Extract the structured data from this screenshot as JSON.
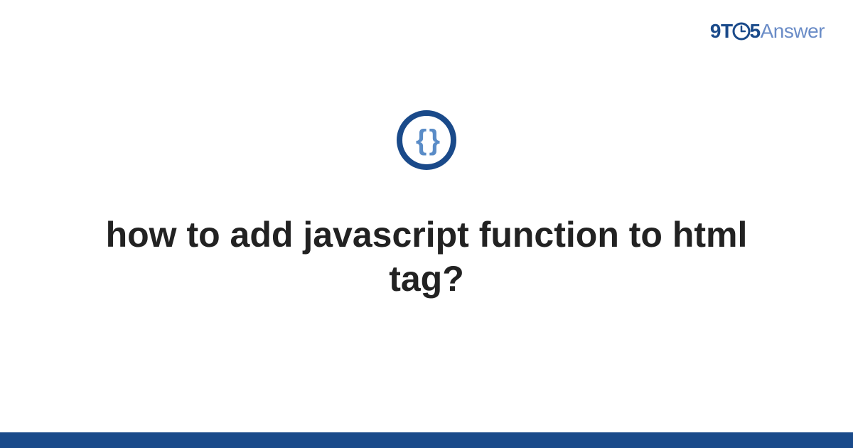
{
  "logo": {
    "nine": "9",
    "t": "T",
    "five": "5",
    "answer": "Answer"
  },
  "icon": {
    "name": "braces-icon",
    "glyph": "{ }"
  },
  "title": "how to add javascript function to html tag?",
  "colors": {
    "brand_dark": "#1a4a8a",
    "brand_light": "#6a8cc7",
    "text": "#222222"
  }
}
